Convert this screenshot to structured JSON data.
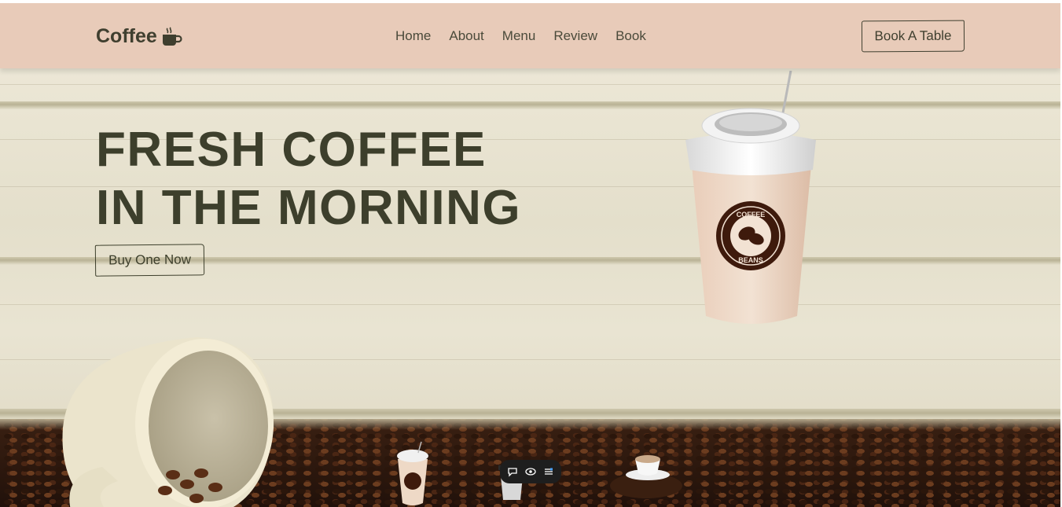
{
  "header": {
    "logo_text": "Coffee",
    "logo_icon": "coffee-cup-icon",
    "nav": [
      "Home",
      "About",
      "Menu",
      "Review",
      "Book"
    ],
    "cta": "Book A Table"
  },
  "hero": {
    "headline_line1": "FRESH COFFEE",
    "headline_line2": "IN THE MORNING",
    "button": "Buy One Now",
    "cup_label_top": "COFFEE",
    "cup_label_bottom": "BEANS"
  },
  "thumbnails": [
    "takeaway-cup-thumbnail",
    "black-cup-thumbnail",
    "coffee-saucer-thumbnail"
  ],
  "toolbar": {
    "icons": [
      "chat-bubble-icon",
      "eye-icon",
      "sliders-icon"
    ]
  },
  "colors": {
    "header_bg": "#e8cbb9",
    "text_dark": "#3d3f2c",
    "wall": "#e8e3d0",
    "cup_brand": "#3e1a0c"
  }
}
